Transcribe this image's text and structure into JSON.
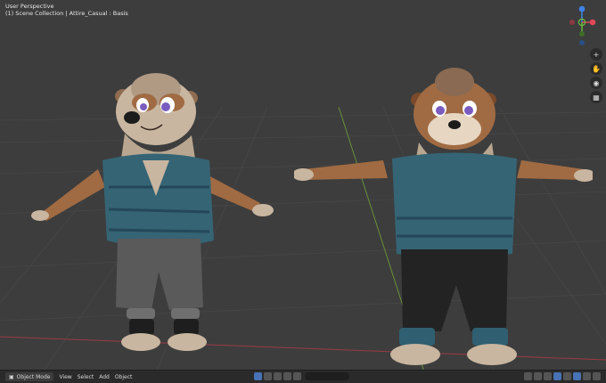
{
  "viewport": {
    "header_line1": "User Perspective",
    "header_line2": "(1) Scene Collection | Attire_Casual : Basis"
  },
  "gizmo": {
    "axis_y_label": "Y",
    "axis_x_label": "X",
    "colors": {
      "x": "#e04858",
      "y": "#6cbd3a",
      "z": "#3f82e6"
    }
  },
  "nav_icons": [
    "zoom-icon",
    "pan-hand-icon",
    "camera-icon",
    "grid-perspective-icon"
  ],
  "bottom_bar": {
    "mode": "Object Mode",
    "menu": [
      "View",
      "Select",
      "Add",
      "Object"
    ]
  },
  "colors": {
    "background": "#3d3d3d",
    "x_axis_line": "#9b3a44",
    "y_axis_line": "#6a8f3a",
    "fur": "#a06b43",
    "fur_light": "#c9b6a0",
    "shirt": "#356474",
    "pants_gray": "#5a5a5a",
    "pants_black": "#232323"
  }
}
